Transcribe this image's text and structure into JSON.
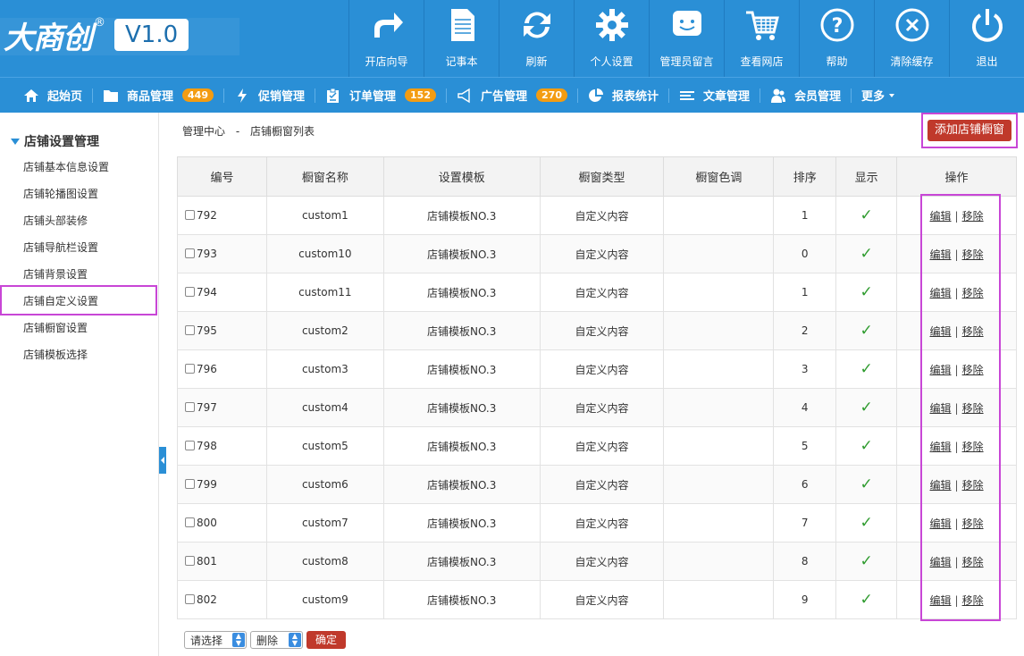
{
  "logo": {
    "text": "大商创",
    "reg": "®",
    "version": "V1.0"
  },
  "tools": [
    {
      "label": "开店向导",
      "icon": "share-arrow-icon"
    },
    {
      "label": "记事本",
      "icon": "notepad-icon"
    },
    {
      "label": "刷新",
      "icon": "refresh-icon"
    },
    {
      "label": "个人设置",
      "icon": "gear-icon"
    },
    {
      "label": "管理员留言",
      "icon": "message-icon"
    },
    {
      "label": "查看网店",
      "icon": "cart-icon"
    },
    {
      "label": "帮助",
      "icon": "help-icon"
    },
    {
      "label": "清除缓存",
      "icon": "clear-icon"
    },
    {
      "label": "退出",
      "icon": "power-icon"
    }
  ],
  "nav": [
    {
      "label": "起始页",
      "icon": "home-icon"
    },
    {
      "label": "商品管理",
      "icon": "folder-icon",
      "badge": "449"
    },
    {
      "label": "促销管理",
      "icon": "bolt-icon"
    },
    {
      "label": "订单管理",
      "icon": "clipboard-icon",
      "badge": "152"
    },
    {
      "label": "广告管理",
      "icon": "megaphone-icon",
      "badge": "270"
    },
    {
      "label": "报表统计",
      "icon": "pie-chart-icon"
    },
    {
      "label": "文章管理",
      "icon": "list-icon"
    },
    {
      "label": "会员管理",
      "icon": "users-icon"
    },
    {
      "label": "更多",
      "icon": "caret-down-icon"
    }
  ],
  "colors": {
    "primary": "#2a8fd6",
    "badge": "#f39c12",
    "danger": "#c0392b",
    "highlight": "#c846d6",
    "check": "#2e9b2e"
  },
  "sidebar": {
    "title": "店铺设置管理",
    "items": [
      "店铺基本信息设置",
      "店铺轮播图设置",
      "店铺头部装修",
      "店铺导航栏设置",
      "店铺背景设置",
      "店铺自定义设置",
      "店铺橱窗设置",
      "店铺模板选择"
    ]
  },
  "breadcrumb": {
    "root": "管理中心",
    "sep": "-",
    "current": "店铺橱窗列表"
  },
  "add_button": "添加店铺橱窗",
  "table": {
    "headers": [
      "编号",
      "橱窗名称",
      "设置模板",
      "橱窗类型",
      "橱窗色调",
      "排序",
      "显示",
      "操作"
    ],
    "rows": [
      {
        "id": "792",
        "name": "custom1",
        "template": "店铺模板NO.3",
        "type": "自定义内容",
        "color": "",
        "order": "1"
      },
      {
        "id": "793",
        "name": "custom10",
        "template": "店铺模板NO.3",
        "type": "自定义内容",
        "color": "",
        "order": "0"
      },
      {
        "id": "794",
        "name": "custom11",
        "template": "店铺模板NO.3",
        "type": "自定义内容",
        "color": "",
        "order": "1"
      },
      {
        "id": "795",
        "name": "custom2",
        "template": "店铺模板NO.3",
        "type": "自定义内容",
        "color": "",
        "order": "2"
      },
      {
        "id": "796",
        "name": "custom3",
        "template": "店铺模板NO.3",
        "type": "自定义内容",
        "color": "",
        "order": "3"
      },
      {
        "id": "797",
        "name": "custom4",
        "template": "店铺模板NO.3",
        "type": "自定义内容",
        "color": "",
        "order": "4"
      },
      {
        "id": "798",
        "name": "custom5",
        "template": "店铺模板NO.3",
        "type": "自定义内容",
        "color": "",
        "order": "5"
      },
      {
        "id": "799",
        "name": "custom6",
        "template": "店铺模板NO.3",
        "type": "自定义内容",
        "color": "",
        "order": "6"
      },
      {
        "id": "800",
        "name": "custom7",
        "template": "店铺模板NO.3",
        "type": "自定义内容",
        "color": "",
        "order": "7"
      },
      {
        "id": "801",
        "name": "custom8",
        "template": "店铺模板NO.3",
        "type": "自定义内容",
        "color": "",
        "order": "8"
      },
      {
        "id": "802",
        "name": "custom9",
        "template": "店铺模板NO.3",
        "type": "自定义内容",
        "color": "",
        "order": "9"
      }
    ],
    "show_mark": "✓",
    "edit_label": "编辑",
    "op_sep": "|",
    "remove_label": "移除"
  },
  "bottom": {
    "select_label": "请选择",
    "action_label": "删除",
    "confirm_label": "确定"
  }
}
